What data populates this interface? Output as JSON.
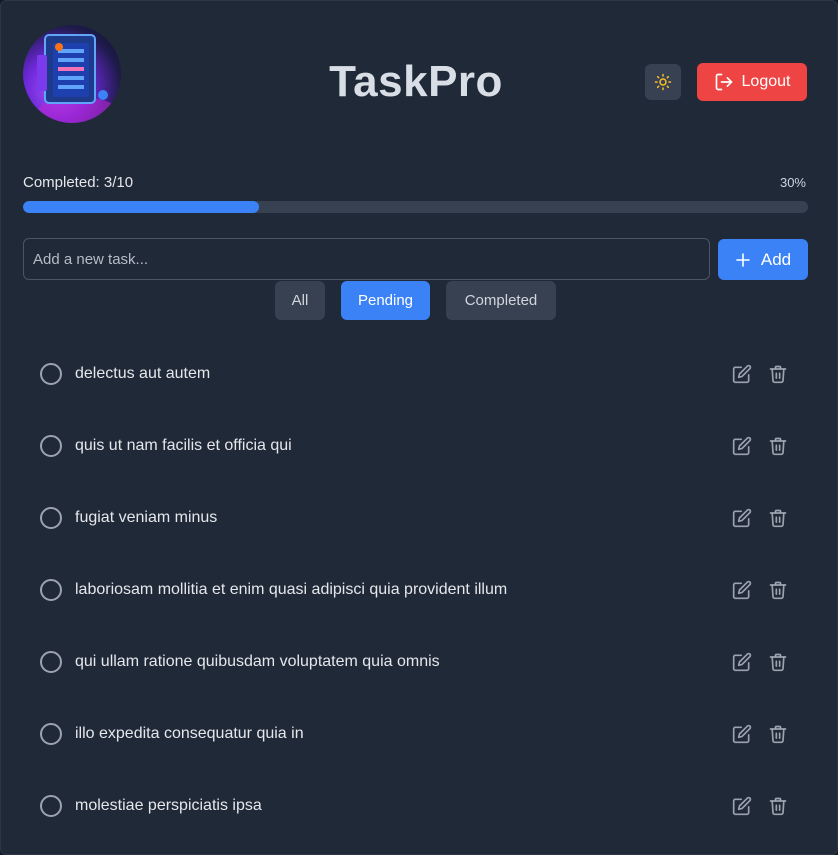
{
  "app": {
    "title": "TaskPro",
    "logout_label": "Logout",
    "accent_color": "#3b82f6",
    "danger_color": "#ef4444"
  },
  "progress": {
    "label": "Completed: 3/10",
    "percent_label": "30%",
    "fraction": 0.3
  },
  "new_task": {
    "placeholder": "Add a new task...",
    "add_label": "Add"
  },
  "filters": [
    {
      "label": "All",
      "active": false
    },
    {
      "label": "Pending",
      "active": true
    },
    {
      "label": "Completed",
      "active": false
    }
  ],
  "tasks": [
    {
      "text": "delectus aut autem",
      "completed": false
    },
    {
      "text": "quis ut nam facilis et officia qui",
      "completed": false
    },
    {
      "text": "fugiat veniam minus",
      "completed": false
    },
    {
      "text": "laboriosam mollitia et enim quasi adipisci quia provident illum",
      "completed": false
    },
    {
      "text": "qui ullam ratione quibusdam voluptatem quia omnis",
      "completed": false
    },
    {
      "text": "illo expedita consequatur quia in",
      "completed": false
    },
    {
      "text": "molestiae perspiciatis ipsa",
      "completed": false
    }
  ],
  "icons": {
    "theme": "sun-icon",
    "logout": "logout-icon",
    "add": "plus-icon",
    "edit": "edit-icon",
    "delete": "trash-icon",
    "task_status": "circle-icon"
  }
}
